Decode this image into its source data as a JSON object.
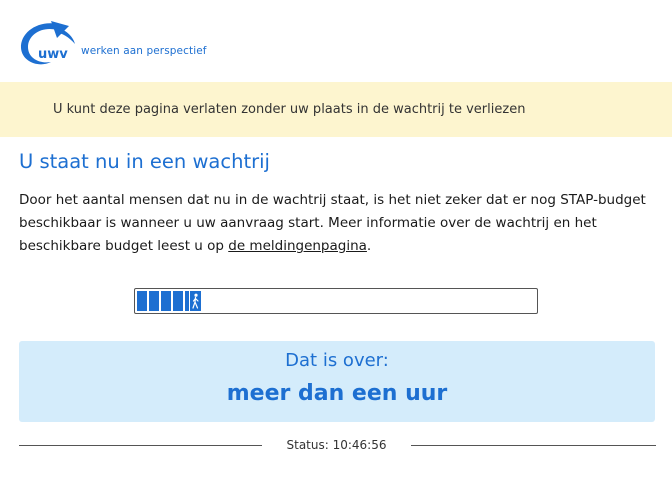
{
  "header": {
    "logo_text": "uwv",
    "tagline": "werken aan perspectief"
  },
  "notice": {
    "text": "U kunt deze pagina verlaten zonder uw plaats in de wachtrij te verliezen"
  },
  "main": {
    "title": "U staat nu in een wachtrij",
    "intro_text": "Door het aantal mensen dat nu in de wachtrij staat, is het niet zeker dat er nog STAP-budget beschikbaar is wanneer u uw aanvraag start. Meer informatie over de wachtrij en het beschikbare budget leest u op ",
    "intro_link": "de meldingenpagina",
    "intro_end": "."
  },
  "progress": {
    "fraction": 0.16,
    "icon": "walking-person-icon"
  },
  "wait": {
    "label": "Dat is over:",
    "time": "meer dan een uur"
  },
  "status": {
    "text": "Status: 10:46:56"
  },
  "colors": {
    "brand_blue": "#1d6fd1",
    "notice_bg": "#fdf5cf",
    "wait_bg": "#d4ecfb"
  }
}
